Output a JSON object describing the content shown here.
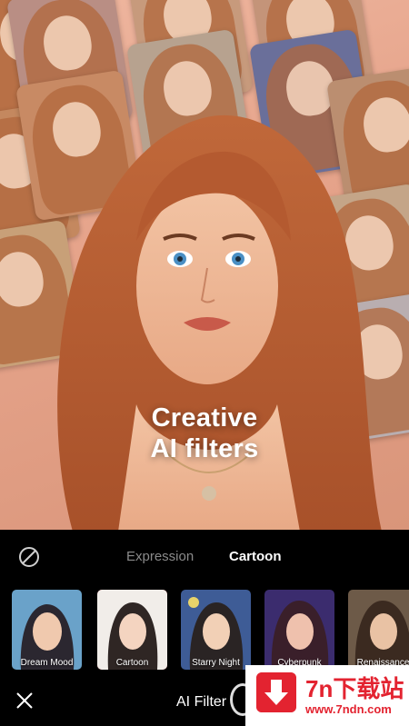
{
  "hero": {
    "headline_line1": "Creative",
    "headline_line2": "AI filters"
  },
  "tabs": [
    {
      "label": "Expression",
      "active": false
    },
    {
      "label": "Cartoon",
      "active": true
    }
  ],
  "filters": [
    {
      "label": "Dream Mood",
      "selected": false
    },
    {
      "label": "Cartoon",
      "selected": true
    },
    {
      "label": "Starry Night",
      "selected": false
    },
    {
      "label": "Cyberpunk",
      "selected": false
    },
    {
      "label": "Renaissance",
      "selected": false
    }
  ],
  "footer": {
    "title": "AI Filter"
  },
  "watermark": {
    "title": "7n下载站",
    "url": "www.7ndn.com"
  },
  "colors": {
    "accent": "#e8424f",
    "watermark_red": "#e32330"
  },
  "icons": {
    "no_filter": "none-icon",
    "close": "close-icon",
    "download": "download-arrow-icon"
  }
}
